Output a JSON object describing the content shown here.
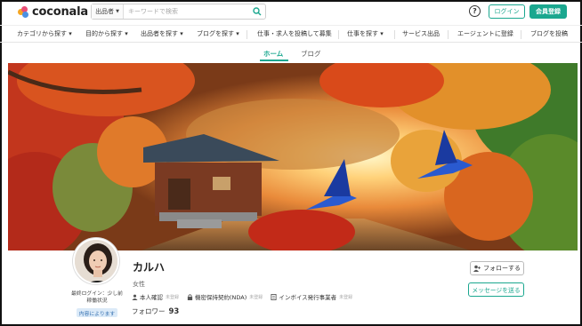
{
  "header": {
    "logo_text": "coconala",
    "search_select": "出品者",
    "search_placeholder": "キーワードで検索",
    "help_label": "?",
    "login_label": "ログイン",
    "register_label": "会員登録"
  },
  "nav": {
    "items": [
      "カテゴリから探す",
      "目的から探す",
      "出品者を探す",
      "ブログを探す",
      "仕事・求人を投稿して募集",
      "仕事を探す",
      "サービス出品",
      "エージェントに登録",
      "ブログを投稿"
    ]
  },
  "tabs": {
    "home": "ホーム",
    "blog": "ブログ"
  },
  "profile": {
    "name": "カルハ",
    "gender": "女性",
    "last_login": "最終ログイン：少し前",
    "last_login_sub": "稼働状況",
    "badge": "内容によります",
    "identity": "本人確認",
    "identity_status": "未登録",
    "nda": "機密保持契約(NDA)",
    "nda_status": "未登録",
    "invoice": "インボイス発行事業者",
    "invoice_status": "未登録",
    "follower_label": "フォロワー",
    "follower_count": "93",
    "follow_button": "フォローする",
    "message_button": "メッセージを送る"
  },
  "colors": {
    "accent": "#1aa78f",
    "badge_bg": "#dbeaf8"
  }
}
